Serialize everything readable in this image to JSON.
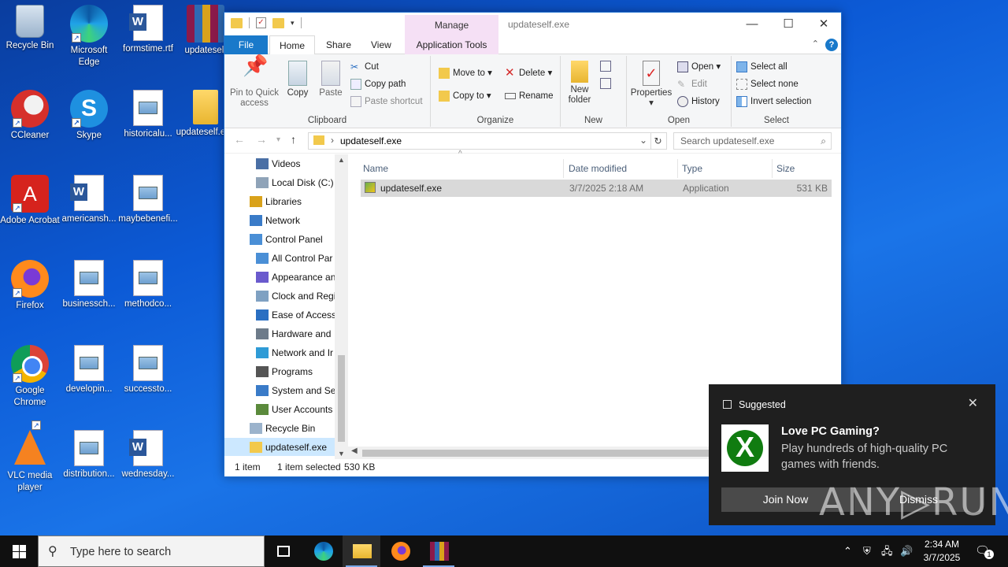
{
  "desktop": {
    "icons": [
      {
        "label": "Recycle Bin",
        "icon": "recycle-bin-icon"
      },
      {
        "label": "Microsoft Edge",
        "icon": "edge-icon"
      },
      {
        "label": "formstime.rtf",
        "icon": "word-doc-icon"
      },
      {
        "label": "updateself",
        "icon": "winrar-archive-icon"
      },
      {
        "label": "CCleaner",
        "icon": "ccleaner-icon"
      },
      {
        "label": "Skype",
        "icon": "skype-icon"
      },
      {
        "label": "historicalu...",
        "icon": "image-doc-icon"
      },
      {
        "label": "updateself.exe",
        "icon": "folder-icon"
      },
      {
        "label": "Adobe Acrobat",
        "icon": "acrobat-icon"
      },
      {
        "label": "americansh...",
        "icon": "word-doc-icon"
      },
      {
        "label": "maybebenefi...",
        "icon": "image-doc-icon"
      },
      {
        "label": "Firefox",
        "icon": "firefox-icon"
      },
      {
        "label": "businessch...",
        "icon": "image-doc-icon"
      },
      {
        "label": "methodco...",
        "icon": "image-doc-icon"
      },
      {
        "label": "Google Chrome",
        "icon": "chrome-icon"
      },
      {
        "label": "developin...",
        "icon": "image-doc-icon"
      },
      {
        "label": "successto...",
        "icon": "image-doc-icon"
      },
      {
        "label": "VLC media player",
        "icon": "vlc-icon"
      },
      {
        "label": "distribution...",
        "icon": "image-doc-icon"
      },
      {
        "label": "wednesday...",
        "icon": "word-doc-icon"
      }
    ]
  },
  "explorer": {
    "title": "updateself.exe",
    "manage_tab": "Manage",
    "tabs": {
      "file": "File",
      "home": "Home",
      "share": "Share",
      "view": "View",
      "app_tools": "Application Tools"
    },
    "ribbon": {
      "clipboard": {
        "label": "Clipboard",
        "pin": "Pin to Quick access",
        "copy": "Copy",
        "paste": "Paste",
        "cut": "Cut",
        "copy_path": "Copy path",
        "paste_shortcut": "Paste shortcut"
      },
      "organize": {
        "label": "Organize",
        "move_to": "Move to",
        "copy_to": "Copy to",
        "delete": "Delete",
        "rename": "Rename"
      },
      "new": {
        "label": "New",
        "new_folder": "New folder"
      },
      "open": {
        "label": "Open",
        "properties": "Properties",
        "open": "Open",
        "edit": "Edit",
        "history": "History"
      },
      "select": {
        "label": "Select",
        "select_all": "Select all",
        "select_none": "Select none",
        "invert": "Invert selection"
      }
    },
    "address": {
      "path": "updateself.exe",
      "search_placeholder": "Search updateself.exe"
    },
    "nav_items": [
      {
        "label": "Videos",
        "icon": "videos-folder-icon",
        "indent": 1
      },
      {
        "label": "Local Disk (C:)",
        "icon": "drive-icon",
        "indent": 1
      },
      {
        "label": "Libraries",
        "icon": "libraries-icon",
        "indent": 0
      },
      {
        "label": "Network",
        "icon": "network-icon",
        "indent": 0
      },
      {
        "label": "Control Panel",
        "icon": "control-panel-icon",
        "indent": 0
      },
      {
        "label": "All Control Par",
        "icon": "control-panel-icon",
        "indent": 1
      },
      {
        "label": "Appearance an",
        "icon": "appearance-icon",
        "indent": 1
      },
      {
        "label": "Clock and Regi",
        "icon": "clock-icon",
        "indent": 1
      },
      {
        "label": "Ease of Access",
        "icon": "ease-of-access-icon",
        "indent": 1
      },
      {
        "label": "Hardware and",
        "icon": "hardware-icon",
        "indent": 1
      },
      {
        "label": "Network and Ir",
        "icon": "network-internet-icon",
        "indent": 1
      },
      {
        "label": "Programs",
        "icon": "programs-icon",
        "indent": 1
      },
      {
        "label": "System and Se",
        "icon": "system-security-icon",
        "indent": 1
      },
      {
        "label": "User Accounts",
        "icon": "user-accounts-icon",
        "indent": 1
      },
      {
        "label": "Recycle Bin",
        "icon": "recycle-bin-icon",
        "indent": 0
      },
      {
        "label": "updateself.exe",
        "icon": "folder-icon",
        "indent": 0,
        "selected": true
      }
    ],
    "columns": {
      "name": "Name",
      "date": "Date modified",
      "type": "Type",
      "size": "Size"
    },
    "files": [
      {
        "name": "updateself.exe",
        "date": "3/7/2025 2:18 AM",
        "type": "Application",
        "size": "531 KB"
      }
    ],
    "status": {
      "count": "1 item",
      "selected": "1 item selected",
      "size": "530 KB"
    }
  },
  "toast": {
    "header": "Suggested",
    "title": "Love PC Gaming?",
    "body": "Play hundreds of high-quality PC games with friends.",
    "join": "Join Now",
    "dismiss": "Dismiss"
  },
  "watermark": "ANY▷RUN",
  "taskbar": {
    "search_placeholder": "Type here to search",
    "time": "2:34 AM",
    "date": "3/7/2025",
    "notification_count": "1"
  }
}
